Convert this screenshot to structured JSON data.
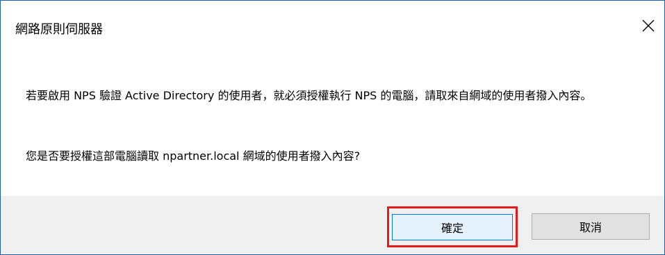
{
  "window": {
    "title": "網路原則伺服器",
    "close_icon": "close-icon"
  },
  "message": {
    "line1": "若要啟用 NPS 驗證 Active Directory 的使用者，就必須授權執行 NPS 的電腦，請取來自網域的使用者撥入內容。",
    "line2": "您是否要授權這部電腦讀取 npartner.local 網域的使用者撥入內容?"
  },
  "buttons": {
    "ok_label": "確定",
    "cancel_label": "取消"
  },
  "colors": {
    "highlight": "#e11b1b",
    "border": "#1f5fa8",
    "ok_border": "#0078d7"
  }
}
